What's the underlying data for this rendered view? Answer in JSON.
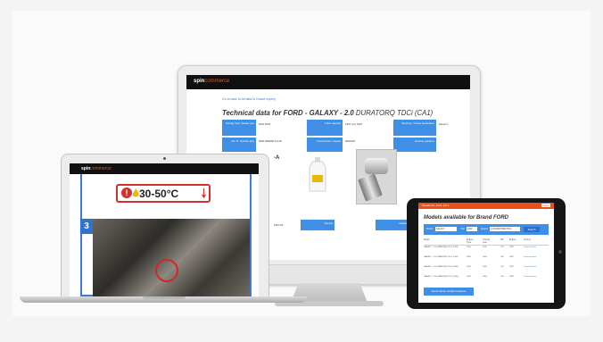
{
  "imac": {
    "logo": "spin",
    "logo_sub": "commerce",
    "breadcrumb": "Go to back to All data lo Ooaoe equery",
    "title_bold": "Technical data for FORD - GALAXY - 2.0",
    "title_light": "DURATORQ TDCi (CA1)",
    "row1": [
      {
        "label": "Overlay Year / Model year",
        "value": "2010 2015"
      },
      {
        "label": "Cubic capacity",
        "value": "1997 ccm 1997"
      },
      {
        "label": "Brochure / Power Destination",
        "value": "Diesel C"
      }
    ],
    "row2": [
      {
        "label": "Oil / N° Number (Hz)",
        "value": "0000 DB0000-5 5.00"
      },
      {
        "label": "Transmission / Speed",
        "value": "0000000"
      },
      {
        "label": "Number cylinders",
        "value": ""
      }
    ],
    "ellipsis": "-A",
    "bottom_values": [
      "1367-60",
      "Ramsis",
      "Adapter"
    ]
  },
  "laptop": {
    "logo": "spin",
    "logo_sub": "commerce",
    "temp_range": "30-50°C",
    "warn_icon_text": "!",
    "step_number": "3"
  },
  "tablet": {
    "header": "Models list, Ford, Vol 1",
    "close_label": "Close",
    "title": "Models available for Brand FORD",
    "filter": {
      "model_label": "Model",
      "model_value": "GALAXY",
      "year_label": "Year",
      "year_value": "2010",
      "engine_label": "Engine",
      "engine_value": "2.0 DURATORQ TDCi",
      "search": "Search"
    },
    "columns": [
      "Model",
      "Engine Type",
      "Overlay year",
      "kW",
      "Engine",
      "Volume"
    ],
    "rows": [
      [
        "GALAXY - 2.0 DURATORQ TDCi (CA1)",
        "2010",
        "2015",
        "103",
        "1997",
        "Technical data"
      ],
      [
        "GALAXY - 2.0 DURATORQ TDCi (CA1)",
        "2010",
        "2015",
        "100",
        "1997",
        "Technical data"
      ],
      [
        "GALAXY - 2.0 DURATORQ TDCi (CA1)",
        "2010",
        "2015",
        "120",
        "1997",
        "Technical data"
      ],
      [
        "GALAXY - 2.0 DURATORQ TDCi (CA1)",
        "2010",
        "2015",
        "133",
        "1997",
        "Technical data"
      ]
    ],
    "button": "Some Same model Frowerse"
  }
}
